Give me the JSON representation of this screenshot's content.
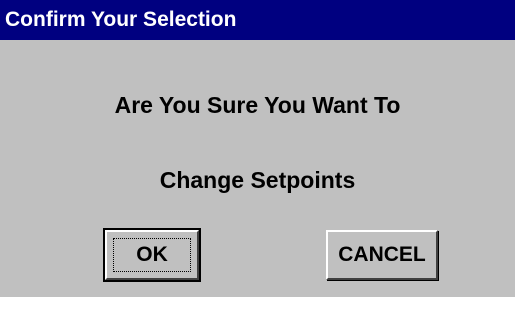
{
  "window": {
    "title": "Confirm Your Selection"
  },
  "message": {
    "line1": "Are You Sure You Want To",
    "line2": "Change Setpoints"
  },
  "buttons": {
    "ok_label": "OK",
    "cancel_label": "CANCEL"
  },
  "colors": {
    "titlebar": "#000080",
    "dialog_background": "#c0c0c0",
    "title_text": "#ffffff"
  }
}
